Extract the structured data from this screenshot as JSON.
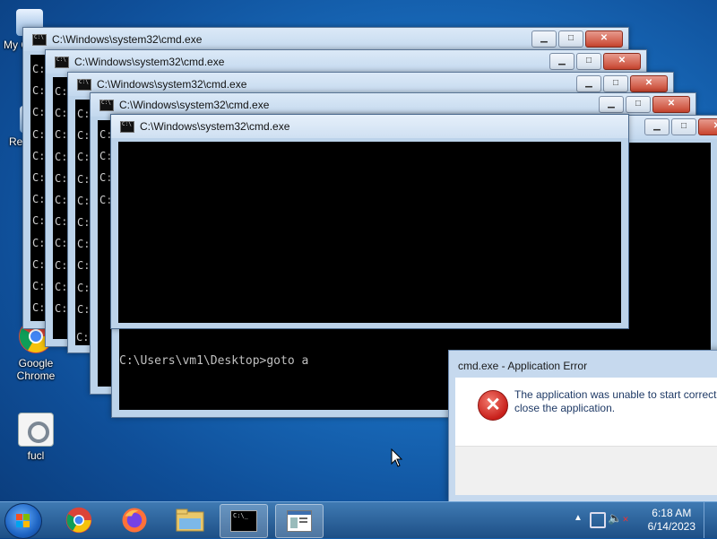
{
  "desktop": {
    "icons": [
      {
        "name": "My Computer",
        "label": "My C"
      },
      {
        "name": "Recycle Bin",
        "label": "Rec"
      },
      {
        "name": "Google Chrome",
        "label": "Google Chrome",
        "line1": "Google",
        "line2": "Chrome"
      },
      {
        "name": "fucl",
        "label": "fucl"
      }
    ]
  },
  "cmd_windows": {
    "title": "C:\\Windows\\system32\\cmd.exe",
    "line_prefix": "C:",
    "prompt": "C:\\Users\\vm1\\Desktop>goto a"
  },
  "error_dialog": {
    "title": "cmd.exe - Application Error",
    "message_line1": "The application was unable to start correctl",
    "message_line2": "close the application."
  },
  "taskbar": {
    "items": [
      "Start",
      "Google Chrome",
      "Firefox",
      "File Explorer",
      "Command Prompt",
      "Application Window"
    ],
    "clock_time": "6:18 AM",
    "clock_date": "6/14/2023"
  },
  "colors": {
    "desktop": "#1a6fc0",
    "taskbar": "#2a5f98",
    "console_bg": "#000000",
    "error_red": "#c8201b"
  }
}
